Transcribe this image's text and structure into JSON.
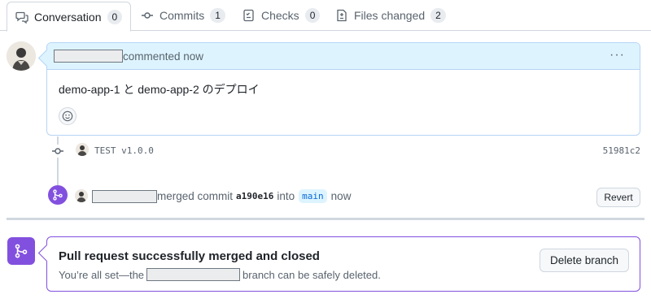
{
  "tabs": [
    {
      "label": "Conversation",
      "count": "0",
      "icon": "comment-discussion-icon",
      "active": true
    },
    {
      "label": "Commits",
      "count": "1",
      "icon": "git-commit-icon"
    },
    {
      "label": "Checks",
      "count": "0",
      "icon": "checklist-icon"
    },
    {
      "label": "Files changed",
      "count": "2",
      "icon": "file-diff-icon"
    }
  ],
  "comment": {
    "meta": "commented now",
    "menu": "···",
    "body": "demo-app-1 と demo-app-2 のデプロイ"
  },
  "commit": {
    "message": "TEST v1.0.0",
    "sha": "51981c2"
  },
  "merge_event": {
    "text_merged": "merged commit",
    "sha": "a190e16",
    "text_into": "into",
    "branch": "main",
    "time": "now",
    "revert_label": "Revert"
  },
  "merged_box": {
    "title": "Pull request successfully merged and closed",
    "sub_before": "You’re all set—the",
    "sub_after": "branch can be safely deleted.",
    "delete_label": "Delete branch"
  },
  "colors": {
    "accent": "#0969da",
    "merged_purple": "#8250df",
    "header_blue": "#ddf4ff",
    "border": "#d0d7de"
  }
}
